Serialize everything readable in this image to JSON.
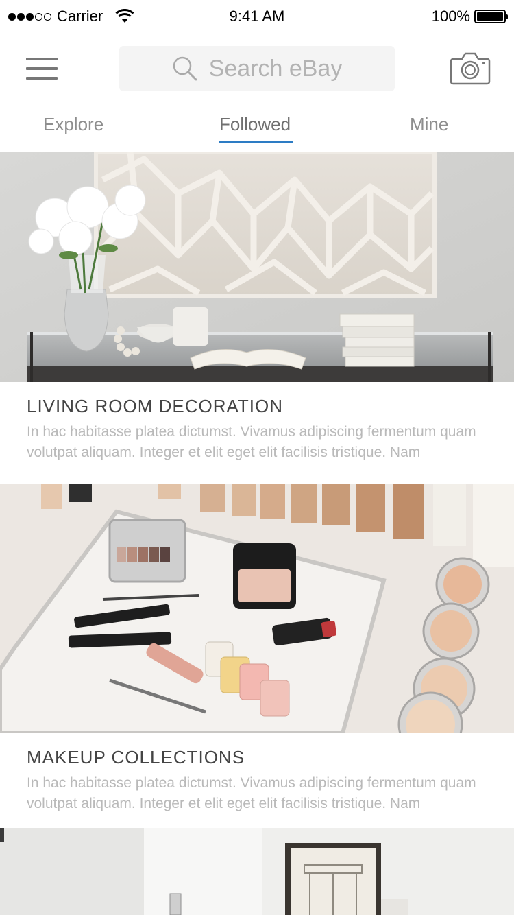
{
  "status_bar": {
    "carrier": "Carrier",
    "time": "9:41 AM",
    "battery": "100%"
  },
  "search": {
    "placeholder": "Search eBay"
  },
  "tabs": [
    {
      "label": "Explore",
      "active": false
    },
    {
      "label": "Followed",
      "active": true
    },
    {
      "label": "Mine",
      "active": false
    }
  ],
  "cards": [
    {
      "title": "LIVING ROOM DECORATION",
      "description": "In hac habitasse platea dictumst. Vivamus adipiscing fermentum quam volutpat aliquam. Integer et elit eget elit facilisis tristique. Nam"
    },
    {
      "title": "MAKEUP COLLECTIONS",
      "description": "In hac habitasse platea dictumst. Vivamus adipiscing fermentum quam volutpat aliquam. Integer et elit eget elit facilisis tristique. Nam"
    }
  ],
  "icons": [
    "menu-icon",
    "search-icon",
    "camera-icon",
    "wifi-icon",
    "battery-icon"
  ],
  "colors": {
    "tab_indicator": "#2d7cc4",
    "search_bg": "#f4f4f4"
  }
}
